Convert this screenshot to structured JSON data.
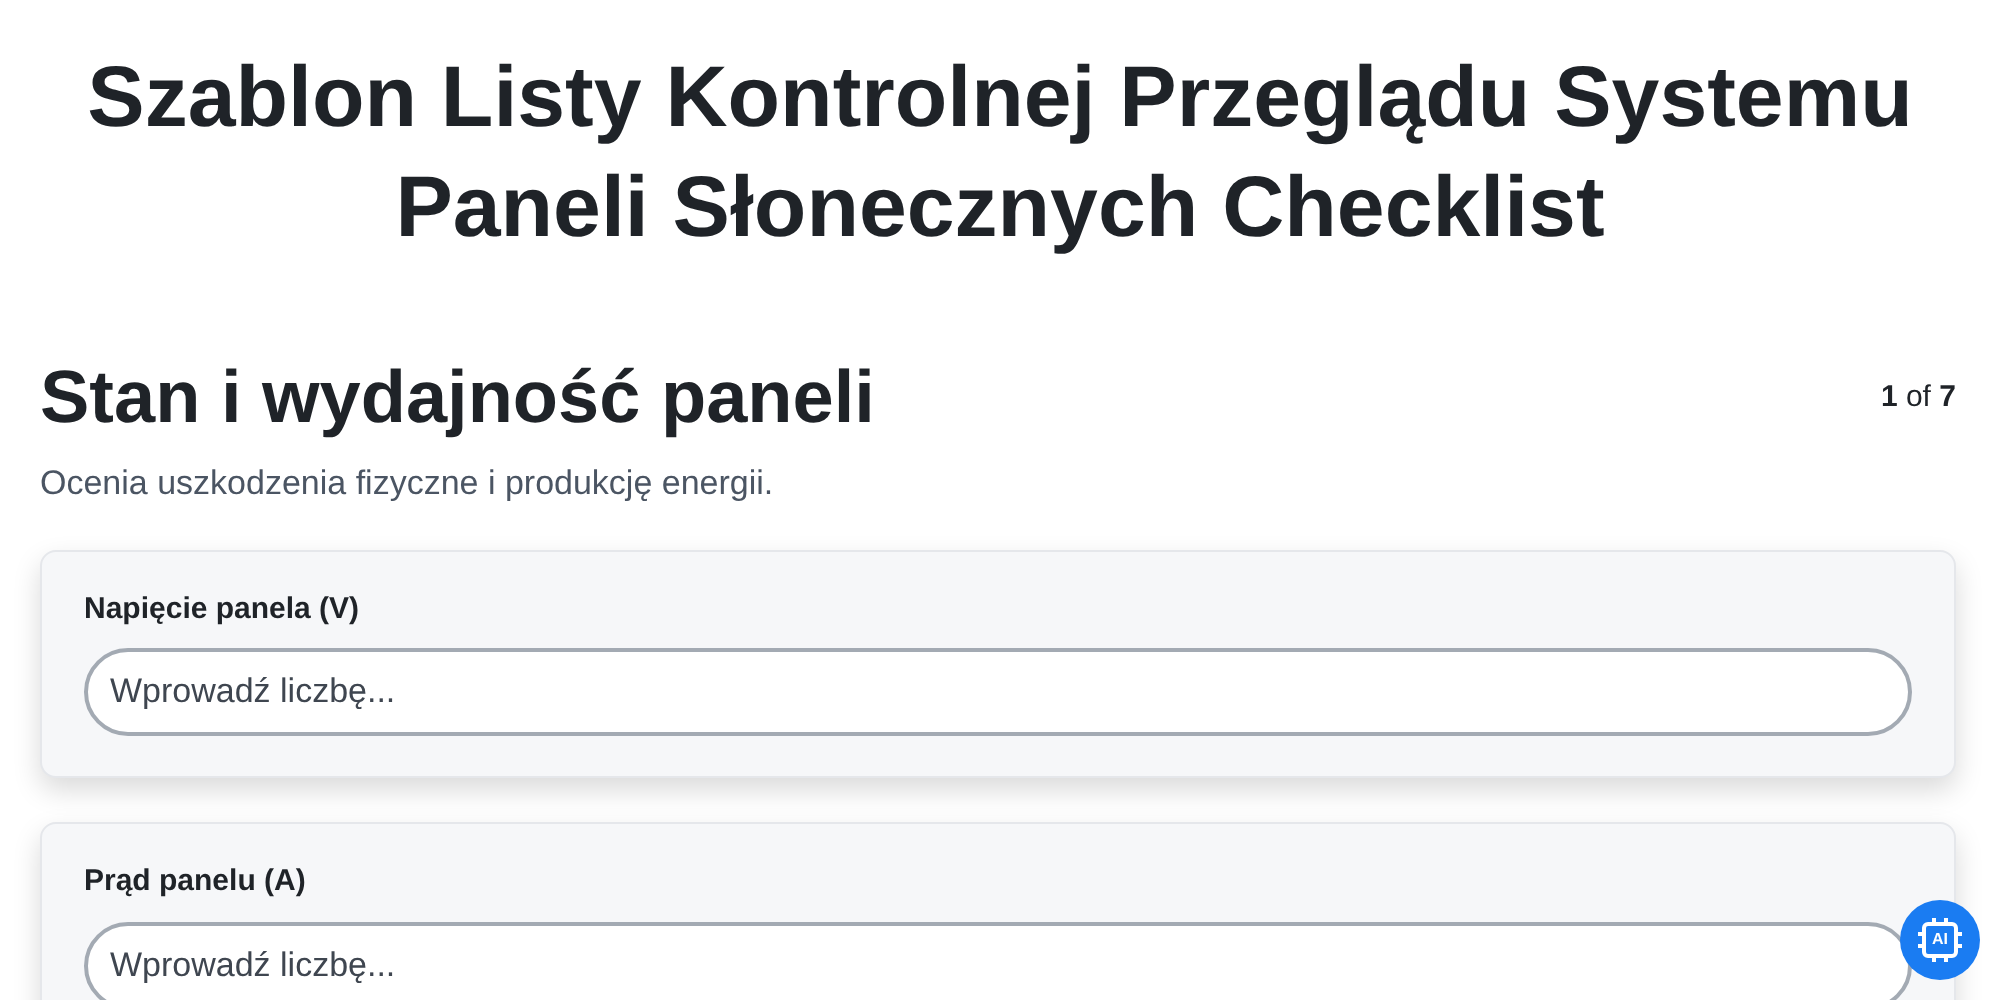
{
  "title": "Szablon Listy Kontrolnej Przeglądu Systemu Paneli Słonecznych Checklist",
  "section": {
    "heading": "Stan i wydajność paneli",
    "step_current": "1",
    "step_of": "of",
    "step_total": "7",
    "description": "Ocenia uszkodzenia fizyczne i produkcję energii."
  },
  "fields": [
    {
      "label": "Napięcie panela (V)",
      "placeholder": "Wprowadź liczbę..."
    },
    {
      "label": "Prąd panelu (A)",
      "placeholder": "Wprowadź liczbę..."
    }
  ],
  "assistant_button": {
    "label": "AI"
  }
}
